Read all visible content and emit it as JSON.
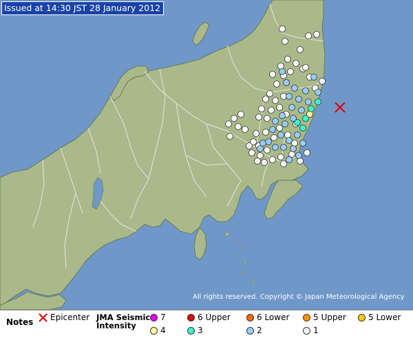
{
  "header": {
    "issued": "Issued at 14:30 JST  28 January 2012"
  },
  "copyright": "All rights reserved. Copyright © Japan Meteorological Agency",
  "legend": {
    "notes_label": "Notes",
    "epicenter_label": "Epicenter",
    "scale_label_1": "JMA Seismic",
    "scale_label_2": "Intensity",
    "intensities": [
      {
        "label": "7",
        "color": "#e600e6"
      },
      {
        "label": "6 Upper",
        "color": "#e00000"
      },
      {
        "label": "6 Lower",
        "color": "#ff6600"
      },
      {
        "label": "5 Upper",
        "color": "#ff9900"
      },
      {
        "label": "5 Lower",
        "color": "#ffcc00"
      },
      {
        "label": "4",
        "color": "#ffff99"
      },
      {
        "label": "3",
        "color": "#33ffcc"
      },
      {
        "label": "2",
        "color": "#99ccff"
      },
      {
        "label": "1",
        "color": "#ffffff"
      }
    ]
  },
  "colors": {
    "sea": "#6f98c8",
    "land": "#a9b98a",
    "boundary": "#e6e6e6",
    "epicenter": "#e00000",
    "header_bg": "#1a43a8"
  }
}
